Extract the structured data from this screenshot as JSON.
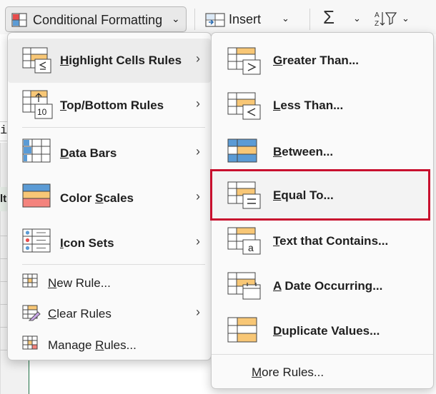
{
  "ribbon": {
    "conditional_formatting": {
      "label": "Conditional Formatting",
      "chevron": "⌄",
      "icon": "conditional-formatting-icon"
    },
    "insert": {
      "label": "Insert",
      "chevron": "⌄",
      "icon": "insert-cells-icon"
    },
    "autosum": {
      "glyph": "Σ",
      "chevron": "⌄",
      "icon": "autosum-icon"
    },
    "sort_filter": {
      "chevron": "⌄",
      "icon": "sort-filter-icon"
    }
  },
  "sheet": {
    "formula_fragment": "i",
    "row_header_fragment": "lt"
  },
  "main_menu": {
    "items": [
      {
        "pre": "",
        "ul": "H",
        "post": "ighlight Cells Rules",
        "icon": "highlight-cells-rules-icon",
        "submenu": true
      },
      {
        "pre": "",
        "ul": "T",
        "post": "op/Bottom Rules",
        "icon": "top-bottom-rules-icon",
        "submenu": true
      },
      {
        "pre": "",
        "ul": "D",
        "post": "ata Bars",
        "icon": "data-bars-icon",
        "submenu": true
      },
      {
        "pre": "Color ",
        "ul": "S",
        "post": "cales",
        "icon": "color-scales-icon",
        "submenu": true
      },
      {
        "pre": "",
        "ul": "I",
        "post": "con Sets",
        "icon": "icon-sets-icon",
        "submenu": true
      },
      {
        "pre": "",
        "ul": "N",
        "post": "ew Rule...",
        "icon": "new-rule-icon",
        "submenu": false
      },
      {
        "pre": "",
        "ul": "C",
        "post": "lear Rules",
        "icon": "clear-rules-icon",
        "submenu": true
      },
      {
        "pre": "Manage ",
        "ul": "R",
        "post": "ules...",
        "icon": "manage-rules-icon",
        "submenu": false
      }
    ]
  },
  "sub_menu": {
    "items": [
      {
        "pre": "",
        "ul": "G",
        "post": "reater Than...",
        "icon": "greater-than-icon"
      },
      {
        "pre": "",
        "ul": "L",
        "post": "ess Than...",
        "icon": "less-than-icon"
      },
      {
        "pre": "",
        "ul": "B",
        "post": "etween...",
        "icon": "between-icon"
      },
      {
        "pre": "",
        "ul": "E",
        "post": "qual To...",
        "icon": "equal-to-icon",
        "highlighted": true
      },
      {
        "pre": "",
        "ul": "T",
        "post": "ext that Contains...",
        "icon": "text-contains-icon"
      },
      {
        "pre": "",
        "ul": "A",
        "post": " Date Occurring...",
        "icon": "date-occurring-icon"
      },
      {
        "pre": "",
        "ul": "D",
        "post": "uplicate Values...",
        "icon": "duplicate-values-icon"
      }
    ],
    "more_rules": {
      "pre": "",
      "ul": "M",
      "post": "ore Rules..."
    }
  },
  "colors": {
    "highlight_border": "#c8102e",
    "cell_orange": "#f8c776",
    "cell_blue": "#5b9bd5",
    "cell_red": "#f4837d"
  }
}
